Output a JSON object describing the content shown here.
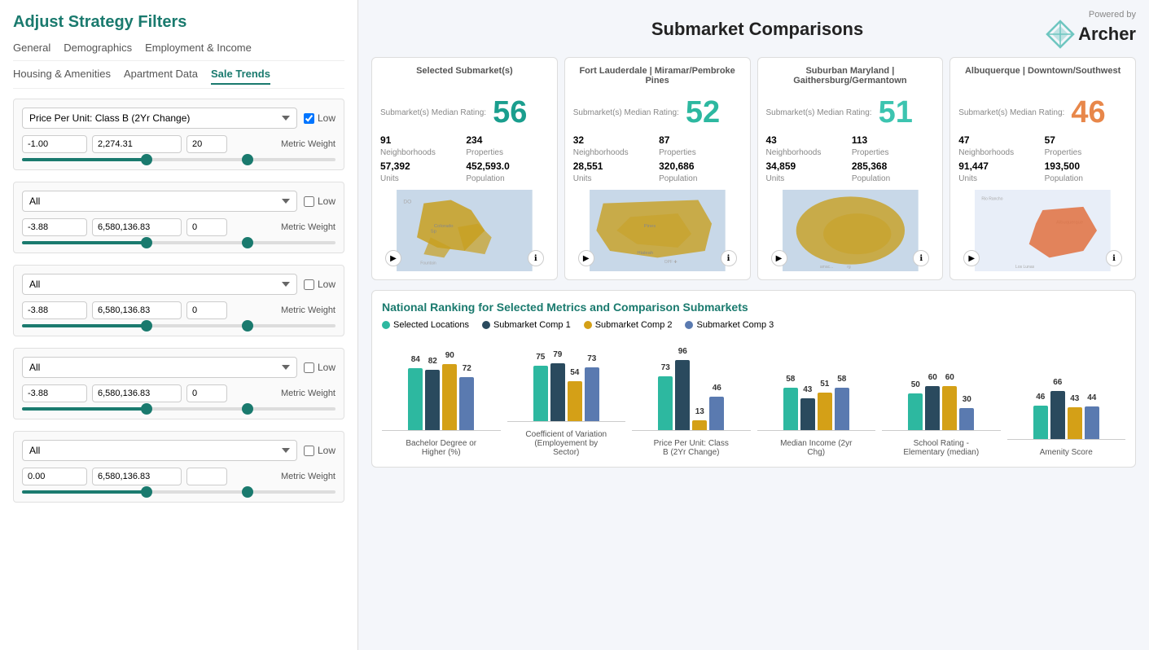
{
  "left": {
    "title": "Adjust Strategy Filters",
    "tabs_row1": [
      {
        "label": "General",
        "active": false
      },
      {
        "label": "Demographics",
        "active": false
      },
      {
        "label": "Employment & Income",
        "active": false
      }
    ],
    "tabs_row2": [
      {
        "label": "Housing & Amenities",
        "active": false
      },
      {
        "label": "Apartment Data",
        "active": false
      },
      {
        "label": "Sale Trends",
        "active": true
      }
    ],
    "filters": [
      {
        "select_value": "Price Per Unit: Class B (2Yr Change)",
        "low_checked": true,
        "inputs": [
          "-1.00",
          "2,274.31",
          "20"
        ],
        "metric_weight": "Metric Weight"
      },
      {
        "select_value": "All",
        "low_checked": false,
        "inputs": [
          "-3.88",
          "6,580,136.83",
          "0"
        ],
        "metric_weight": "Metric Weight"
      },
      {
        "select_value": "All",
        "low_checked": false,
        "inputs": [
          "-3.88",
          "6,580,136.83",
          "0"
        ],
        "metric_weight": "Metric Weight"
      },
      {
        "select_value": "All",
        "low_checked": false,
        "inputs": [
          "-3.88",
          "6,580,136.83",
          "0"
        ],
        "metric_weight": "Metric Weight"
      },
      {
        "select_value": "All",
        "low_checked": false,
        "inputs": [
          "0.00",
          "6,580,136.83",
          ""
        ],
        "metric_weight": "Metric Weight"
      }
    ]
  },
  "right": {
    "title": "Submarket Comparisons",
    "powered_by": "Powered by",
    "brand_name": "Archer",
    "cards": [
      {
        "id": "selected",
        "header": "Selected Submarket(s)",
        "rating_label": "Submarket(s) Median Rating:",
        "rating": "56",
        "rating_class": "rating-teal",
        "stats": [
          {
            "value": "91",
            "label": "Neighborhoods"
          },
          {
            "value": "234",
            "label": "Properties"
          },
          {
            "value": "57,392",
            "label": "Units"
          },
          {
            "value": "452,593.0",
            "label": "Population"
          }
        ],
        "map_color": "#c8a020"
      },
      {
        "id": "comp1",
        "header": "Fort Lauderdale | Miramar/Pembroke Pines",
        "rating_label": "Submarket(s) Median Rating:",
        "rating": "52",
        "rating_class": "rating-teal2",
        "stats": [
          {
            "value": "32",
            "label": "Neighborhoods"
          },
          {
            "value": "87",
            "label": "Properties"
          },
          {
            "value": "28,551",
            "label": "Units"
          },
          {
            "value": "320,686",
            "label": "Population"
          }
        ],
        "map_color": "#c8a020"
      },
      {
        "id": "comp2",
        "header": "Suburban Maryland | Gaithersburg/Germantown",
        "rating_label": "Submarket(s) Median Rating:",
        "rating": "51",
        "rating_class": "rating-teal3",
        "stats": [
          {
            "value": "43",
            "label": "Neighborhoods"
          },
          {
            "value": "113",
            "label": "Properties"
          },
          {
            "value": "34,859",
            "label": "Units"
          },
          {
            "value": "285,368",
            "label": "Population"
          }
        ],
        "map_color": "#c8a020"
      },
      {
        "id": "comp3",
        "header": "Albuquerque | Downtown/Southwest",
        "rating_label": "Submarket(s) Median Rating:",
        "rating": "46",
        "rating_class": "rating-orange",
        "stats": [
          {
            "value": "47",
            "label": "Neighborhoods"
          },
          {
            "value": "57",
            "label": "Properties"
          },
          {
            "value": "91,447",
            "label": "Units"
          },
          {
            "value": "193,500",
            "label": "Population"
          }
        ],
        "map_color": "#e87040"
      }
    ],
    "ranking": {
      "title": "National Ranking for Selected Metrics and Comparison Submarkets",
      "legend": [
        {
          "label": "Selected Locations",
          "color": "#2db8a0"
        },
        {
          "label": "Submarket Comp 1",
          "color": "#2a4a5e"
        },
        {
          "label": "Submarket Comp 2",
          "color": "#d4a017"
        },
        {
          "label": "Submarket Comp 3",
          "color": "#5a7ab0"
        }
      ],
      "charts": [
        {
          "label": "Bachelor Degree or Higher (%)",
          "bars": [
            {
              "value": 84,
              "color_class": "bar-teal"
            },
            {
              "value": 82,
              "color_class": "bar-dark"
            },
            {
              "value": 90,
              "color_class": "bar-yellow"
            },
            {
              "value": 72,
              "color_class": "bar-blue"
            }
          ]
        },
        {
          "label": "Coefficient of Variation (Employement by Sector)",
          "bars": [
            {
              "value": 75,
              "color_class": "bar-teal"
            },
            {
              "value": 79,
              "color_class": "bar-dark"
            },
            {
              "value": 54,
              "color_class": "bar-yellow"
            },
            {
              "value": 73,
              "color_class": "bar-blue"
            }
          ]
        },
        {
          "label": "Price Per Unit: Class B (2Yr Change)",
          "bars": [
            {
              "value": 73,
              "color_class": "bar-teal"
            },
            {
              "value": 96,
              "color_class": "bar-dark"
            },
            {
              "value": 13,
              "color_class": "bar-yellow"
            },
            {
              "value": 46,
              "color_class": "bar-blue"
            }
          ]
        },
        {
          "label": "Median Income (2yr Chg)",
          "bars": [
            {
              "value": 58,
              "color_class": "bar-teal"
            },
            {
              "value": 43,
              "color_class": "bar-dark"
            },
            {
              "value": 51,
              "color_class": "bar-yellow"
            },
            {
              "value": 58,
              "color_class": "bar-blue"
            }
          ]
        },
        {
          "label": "School Rating - Elementary (median)",
          "bars": [
            {
              "value": 50,
              "color_class": "bar-teal"
            },
            {
              "value": 60,
              "color_class": "bar-dark"
            },
            {
              "value": 60,
              "color_class": "bar-yellow"
            },
            {
              "value": 30,
              "color_class": "bar-blue"
            }
          ]
        },
        {
          "label": "Amenity Score",
          "bars": [
            {
              "value": 46,
              "color_class": "bar-teal"
            },
            {
              "value": 66,
              "color_class": "bar-dark"
            },
            {
              "value": 43,
              "color_class": "bar-yellow"
            },
            {
              "value": 44,
              "color_class": "bar-blue"
            }
          ]
        }
      ]
    }
  }
}
